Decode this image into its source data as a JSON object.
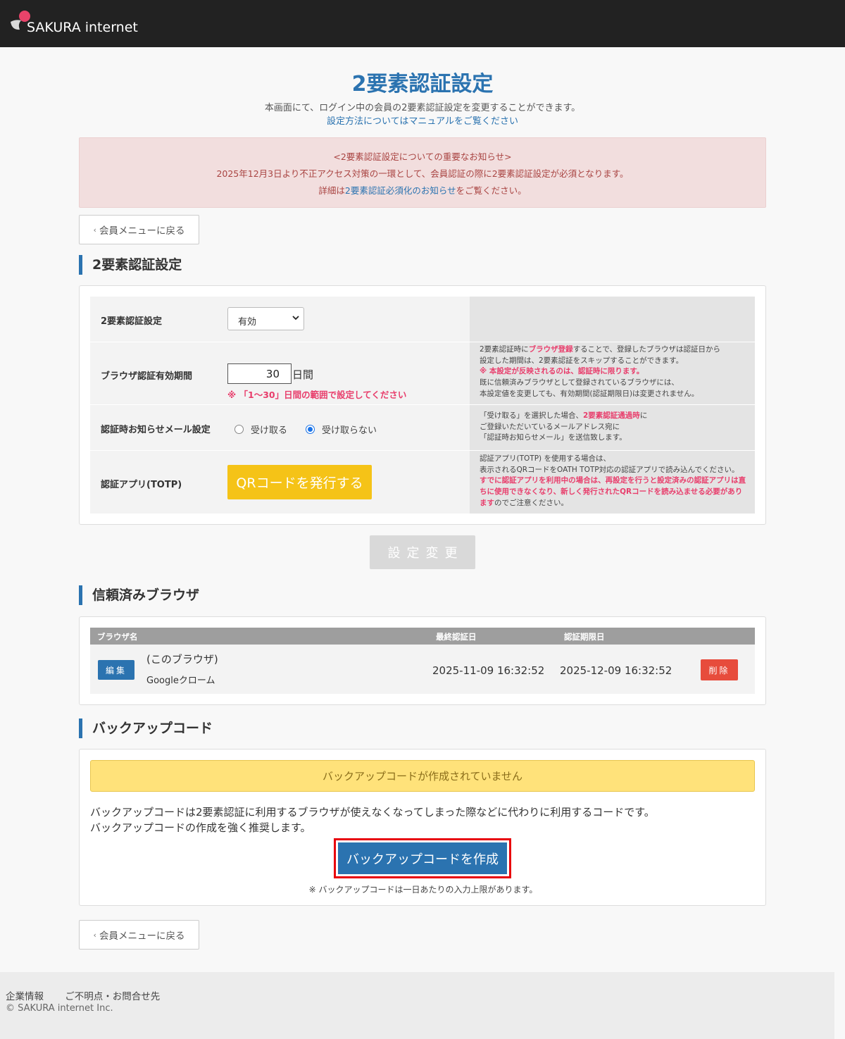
{
  "header": {
    "logo_text": "SAKURA internet"
  },
  "page": {
    "title": "2要素認証設定",
    "description": "本画面にて、ログイン中の会員の2要素認証設定を変更することができます。",
    "manual_link": "設定方法についてはマニュアルをご覧ください"
  },
  "notice": {
    "line1": "<2要素認証設定についての重要なお知らせ>",
    "line2": "2025年12月3日より不正アクセス対策の一環として、会員認証の際に2要素認証設定が必須となります。",
    "line3_prefix": "詳細は",
    "line3_link": "2要素認証必須化のお知らせ",
    "line3_suffix": "をご覧ください。"
  },
  "back_button": {
    "label": "会員メニューに戻る"
  },
  "settings": {
    "section_title": "2要素認証設定",
    "row_2fa": {
      "label": "2要素認証設定",
      "selected": "有効"
    },
    "row_browser": {
      "label": "ブラウザ認証有効期間",
      "value": "30",
      "unit": "日間",
      "note": "※ 「1～30」日間の範囲で設定してください",
      "help1a": "2要素認証時に",
      "help1b": "ブラウザ登録",
      "help1c": "することで、登録したブラウザは認証日から",
      "help2": "設定した期間は、2要素認証をスキップすることができます。",
      "help3": "※ 本設定が反映されるのは、認証時に限ります。",
      "help4": "既に信頼済みブラウザとして登録されているブラウザには、",
      "help5": "本設定値を変更しても、有効期間(認証期限日)は変更されません。"
    },
    "row_mail": {
      "label": "認証時お知らせメール設定",
      "opt_receive": "受け取る",
      "opt_not_receive": "受け取らない",
      "selected": "受け取らない",
      "help1a": "「受け取る」を選択した場合、",
      "help1b": "2要素認証通過時",
      "help1c": "に",
      "help2": "ご登録いただいているメールアドレス宛に",
      "help3": "「認証時お知らせメール」を送信致します。"
    },
    "row_totp": {
      "label": "認証アプリ(TOTP)",
      "button": "QRコードを発行する",
      "help1": "認証アプリ(TOTP) を使用する場合は、",
      "help2": "表示されるQRコードをOATH TOTP対応の認証アプリで読み込んでください。",
      "help3": "すでに認証アプリを利用中の場合は、再設定を行うと設定済みの認証アプリは直",
      "help4": "ちに使用できなくなり、新しく発行されたQRコードを読み込ませる必要があり",
      "help5a": "ます",
      "help5b": "のでご注意ください。"
    },
    "submit_label": "設定変更"
  },
  "trusted": {
    "section_title": "信頼済みブラウザ",
    "columns": [
      "ブラウザ名",
      "最終認証日",
      "認証期限日"
    ],
    "rows": [
      {
        "edit": "編集",
        "name": "(このブラウザ)",
        "kind": "Googleクローム",
        "last_auth": "2025-11-09 16:32:52",
        "expires": "2025-12-09 16:32:52",
        "delete": "削除"
      }
    ]
  },
  "backup": {
    "section_title": "バックアップコード",
    "warning": "バックアップコードが作成されていません",
    "text1": "バックアップコードは2要素認証に利用するブラウザが使えなくなってしまった際などに代わりに利用するコードです。",
    "text2": "バックアップコードの作成を強く推奨します。",
    "create_button": "バックアップコードを作成",
    "note": "※ バックアップコードは一日あたりの入力上限があります。"
  },
  "footer": {
    "link1": "企業情報",
    "link2": "ご不明点・お問合せ先",
    "copyright": "© SAKURA internet Inc."
  },
  "colors": {
    "brand": "#2b73b0",
    "accent_yellow": "#f5c317",
    "danger": "#e74c3c",
    "highlight_red": "#e83e6c"
  }
}
